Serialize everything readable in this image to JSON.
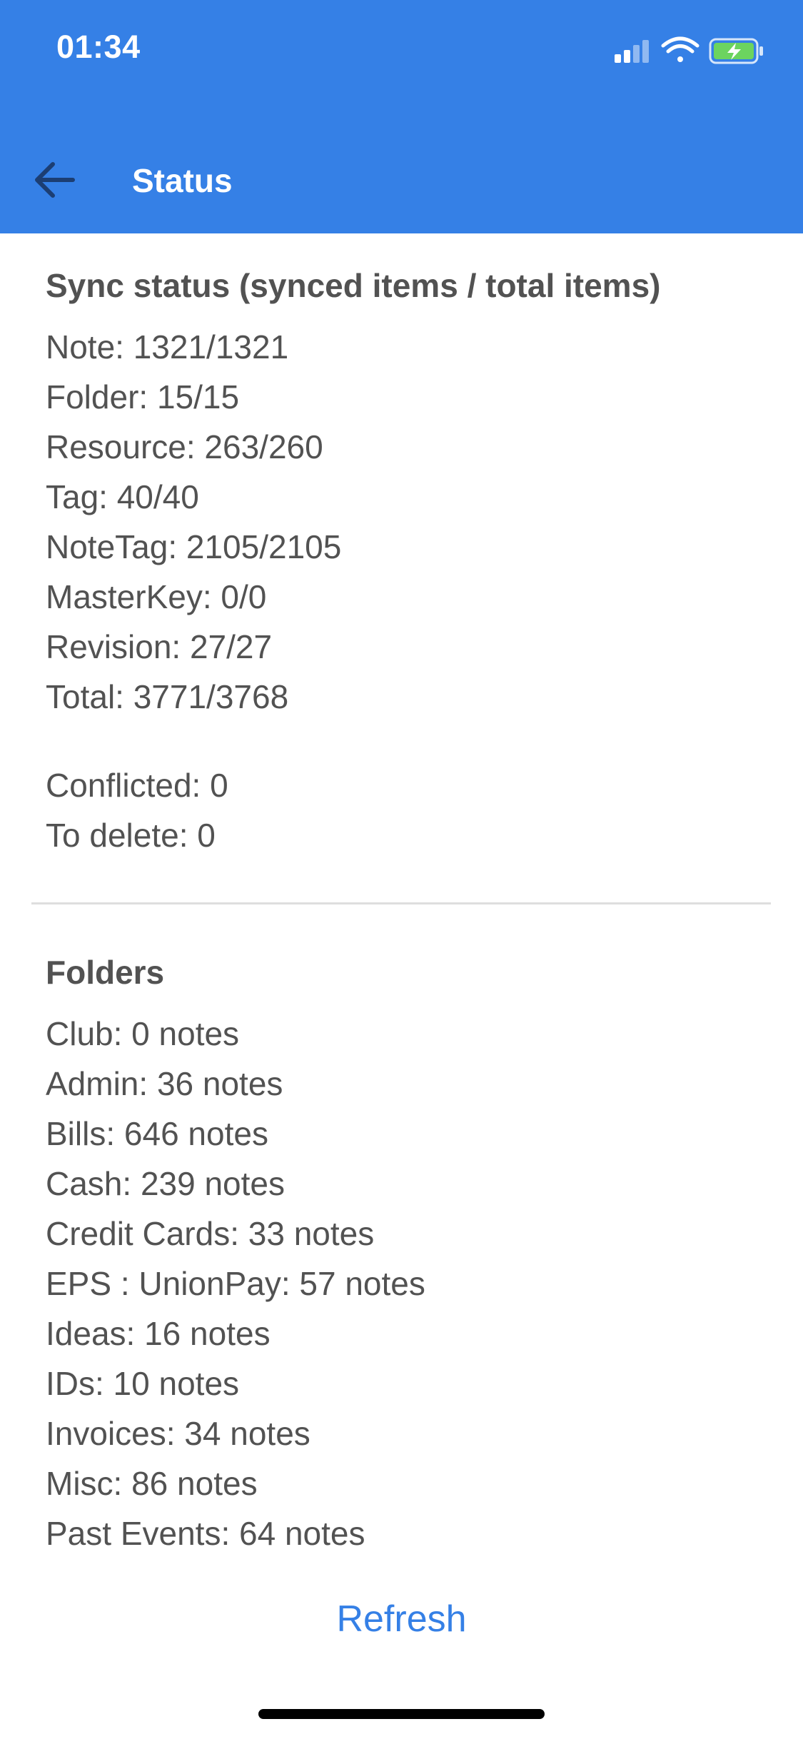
{
  "status_bar": {
    "time": "01:34"
  },
  "header": {
    "title": "Status"
  },
  "sync_status": {
    "heading": "Sync status (synced items / total items)",
    "items": [
      "Note: 1321/1321",
      "Folder: 15/15",
      "Resource: 263/260",
      "Tag: 40/40",
      "NoteTag: 2105/2105",
      "MasterKey: 0/0",
      "Revision: 27/27",
      "Total: 3771/3768"
    ],
    "extra": [
      "Conflicted: 0",
      "To delete: 0"
    ]
  },
  "folders": {
    "heading": "Folders",
    "items": [
      "Club: 0 notes",
      "Admin: 36 notes",
      "Bills: 646 notes",
      "Cash: 239 notes",
      "Credit Cards: 33 notes",
      "EPS : UnionPay: 57 notes",
      "Ideas: 16 notes",
      "IDs: 10 notes",
      "Invoices: 34 notes",
      "Misc: 86 notes",
      "Past Events: 64 notes"
    ]
  },
  "actions": {
    "refresh_label": "Refresh"
  },
  "colors": {
    "accent": "#3580e6",
    "text": "#525252",
    "battery": "#6cd45f"
  }
}
